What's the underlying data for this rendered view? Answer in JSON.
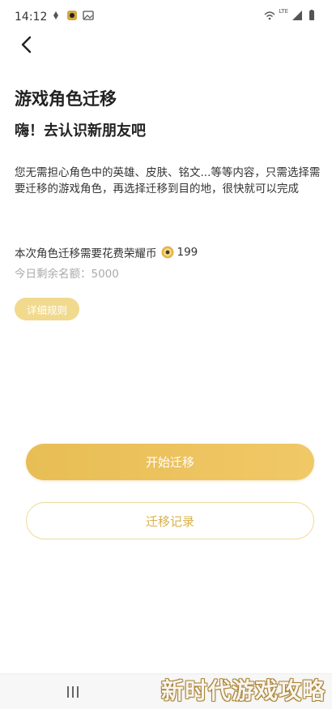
{
  "status_bar": {
    "time": "14:12",
    "network": "LTE"
  },
  "page": {
    "title": "游戏角色迁移",
    "subtitle": "嗨！去认识新朋友吧",
    "description": "您无需担心角色中的英雄、皮肤、铭文...等等内容，只需选择需要迁移的游戏角色，再选择迁移到目的地，很快就可以完成",
    "cost_label": "本次角色迁移需要花费荣耀币",
    "cost_value": "199",
    "quota_text": "今日剩余名额：5000"
  },
  "buttons": {
    "rules": "详细规则",
    "start": "开始迁移",
    "records": "迁移记录"
  },
  "watermark": "新时代游戏攻略",
  "colors": {
    "accent": "#e8bd55",
    "accent_light": "#f1d98e",
    "border": "#eedc9c",
    "record_text": "#d9b24a",
    "quota_text": "#aaaaaa"
  },
  "icons": [
    "back-arrow-icon",
    "coin-icon",
    "wifi-icon",
    "signal-icon",
    "battery-icon",
    "recents-icon"
  ]
}
